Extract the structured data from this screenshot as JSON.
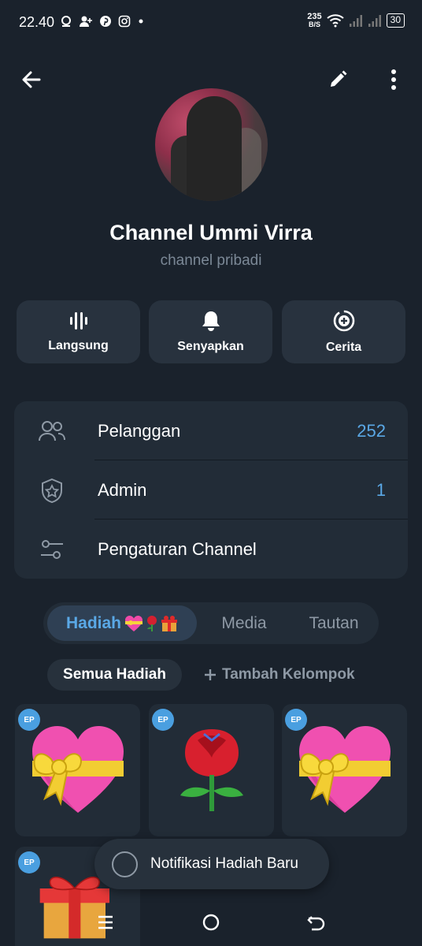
{
  "status_bar": {
    "time": "22.40",
    "net_speed_value": "235",
    "net_speed_unit": "B/S",
    "battery": "30"
  },
  "header": {
    "back_icon": "arrow-left-icon",
    "edit_icon": "pencil-icon",
    "more_icon": "more-vertical-icon"
  },
  "profile": {
    "name": "Channel Ummi Virra",
    "subtitle": "channel pribadi"
  },
  "actions": [
    {
      "label": "Langsung",
      "icon": "live-stream-icon"
    },
    {
      "label": "Senyapkan",
      "icon": "bell-icon"
    },
    {
      "label": "Cerita",
      "icon": "story-add-icon"
    }
  ],
  "info": {
    "subscribers_label": "Pelanggan",
    "subscribers_count": "252",
    "admins_label": "Admin",
    "admins_count": "1",
    "settings_label": "Pengaturan Channel"
  },
  "tabs": [
    {
      "label": "Hadiah",
      "active": true
    },
    {
      "label": "Media",
      "active": false
    },
    {
      "label": "Tautan",
      "active": false
    }
  ],
  "gift_filters": {
    "all_label": "Semua Hadiah",
    "add_group_label": "Tambah Kelompok"
  },
  "gifts": [
    {
      "badge": "EP",
      "type": "heart-with-ribbon"
    },
    {
      "badge": "EP",
      "type": "rose"
    },
    {
      "badge": "EP",
      "type": "heart-with-ribbon"
    },
    {
      "badge": "EP",
      "type": "gift-box"
    }
  ],
  "snackbar": {
    "text": "Notifikasi Hadiah Baru"
  },
  "colors": {
    "background": "#1a222c",
    "card": "#222c37",
    "accent": "#5aa8e6",
    "muted": "#8e99a5"
  }
}
